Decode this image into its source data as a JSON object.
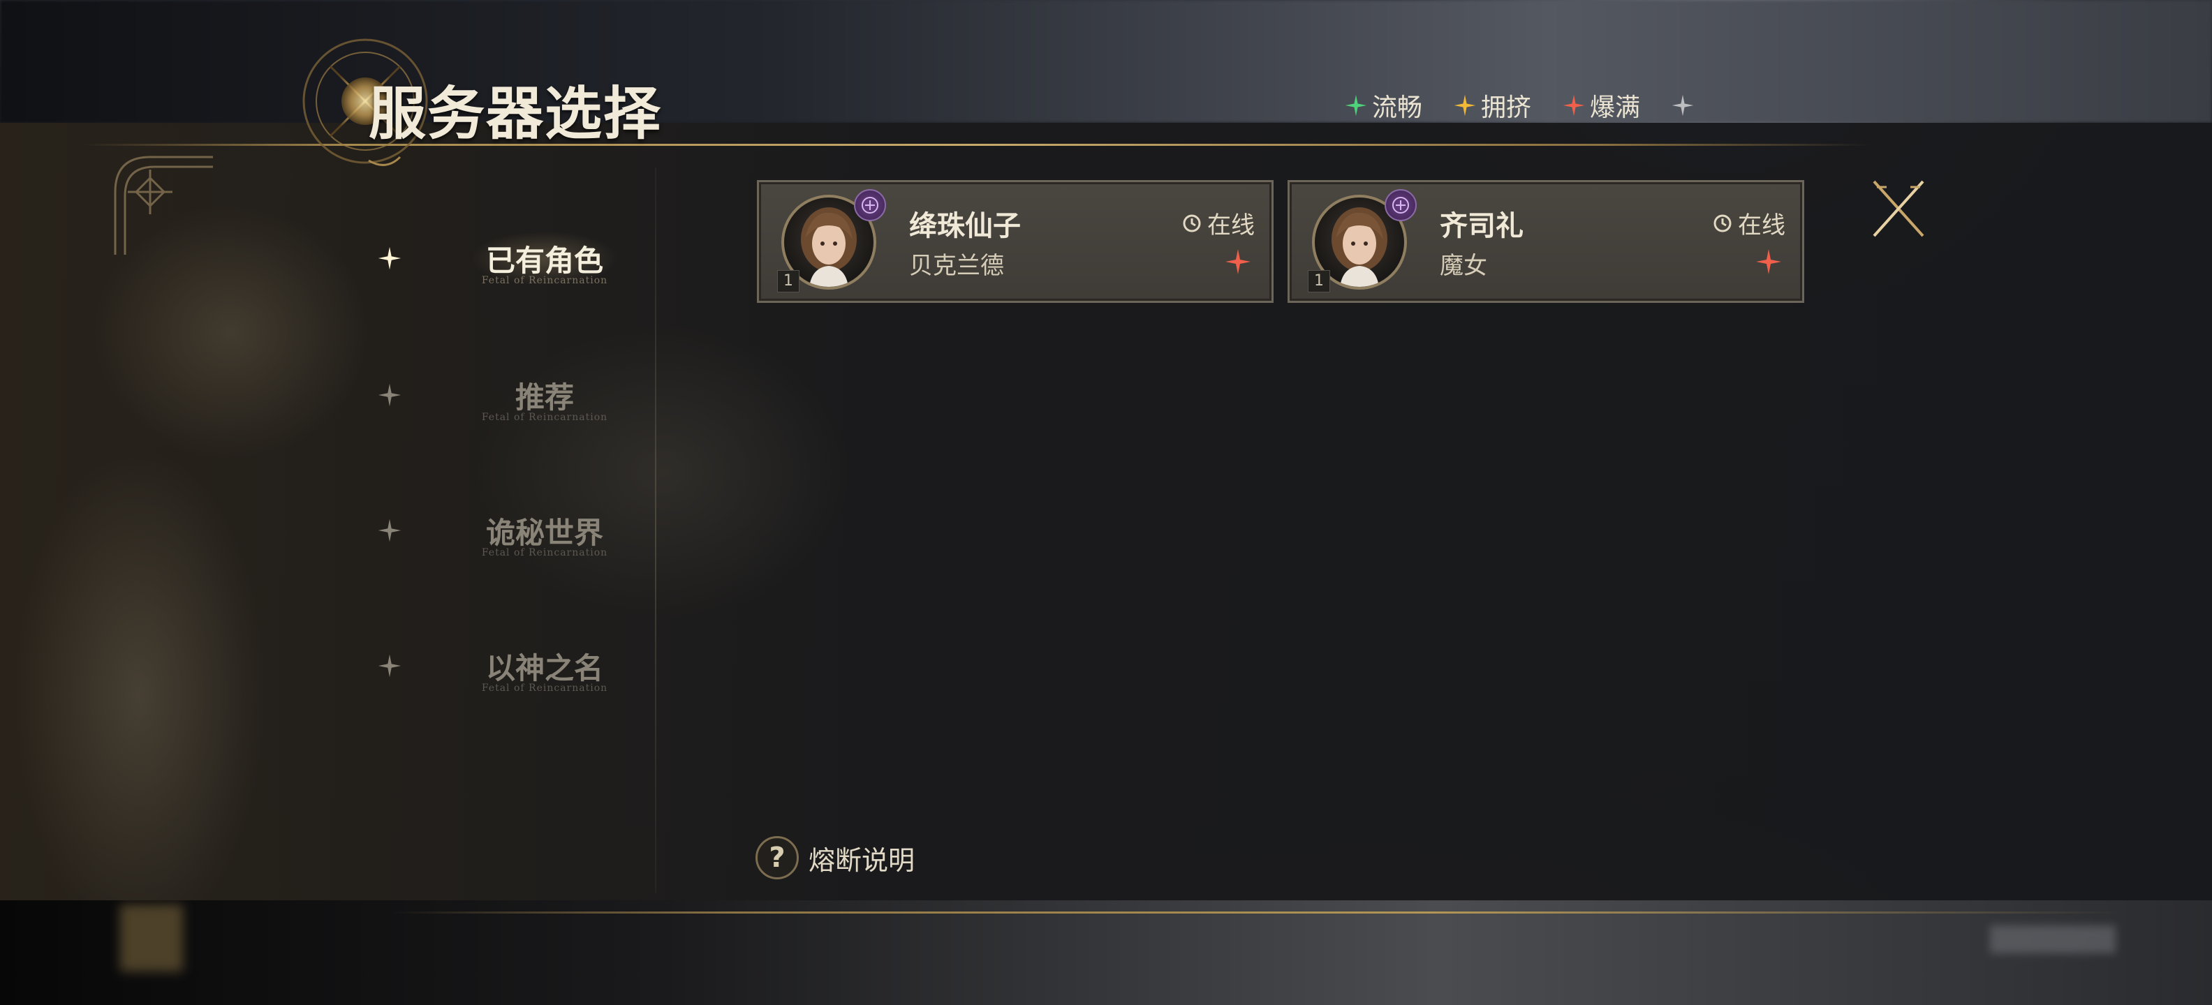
{
  "title": "服务器选择",
  "legend": [
    {
      "label": "流畅",
      "color": "#4fd07a",
      "icon": "sparkle-icon"
    },
    {
      "label": "拥挤",
      "color": "#f2b838",
      "icon": "sparkle-icon"
    },
    {
      "label": "爆满",
      "color": "#f0604a",
      "icon": "sparkle-icon"
    }
  ],
  "nav": [
    {
      "label": "已有角色",
      "sub": "Fetal of Reincarnation",
      "active": true
    },
    {
      "label": "推荐",
      "sub": "Fetal of Reincarnation",
      "active": false
    },
    {
      "label": "诡秘世界",
      "sub": "Fetal of Reincarnation",
      "active": false
    },
    {
      "label": "以神之名",
      "sub": "Fetal of Reincarnation",
      "active": false
    }
  ],
  "characters": [
    {
      "name": "绛珠仙子",
      "server": "贝克兰德",
      "status": "在线",
      "level": "1",
      "load_color": "#f0604a"
    },
    {
      "name": "齐司礼",
      "server": "魔女",
      "status": "在线",
      "level": "1",
      "load_color": "#f0604a"
    }
  ],
  "help_label": "熔断说明",
  "colors": {
    "gold": "#c7aa6a",
    "card_bg": "#45413b",
    "badge_purple": "#6a3f86"
  }
}
